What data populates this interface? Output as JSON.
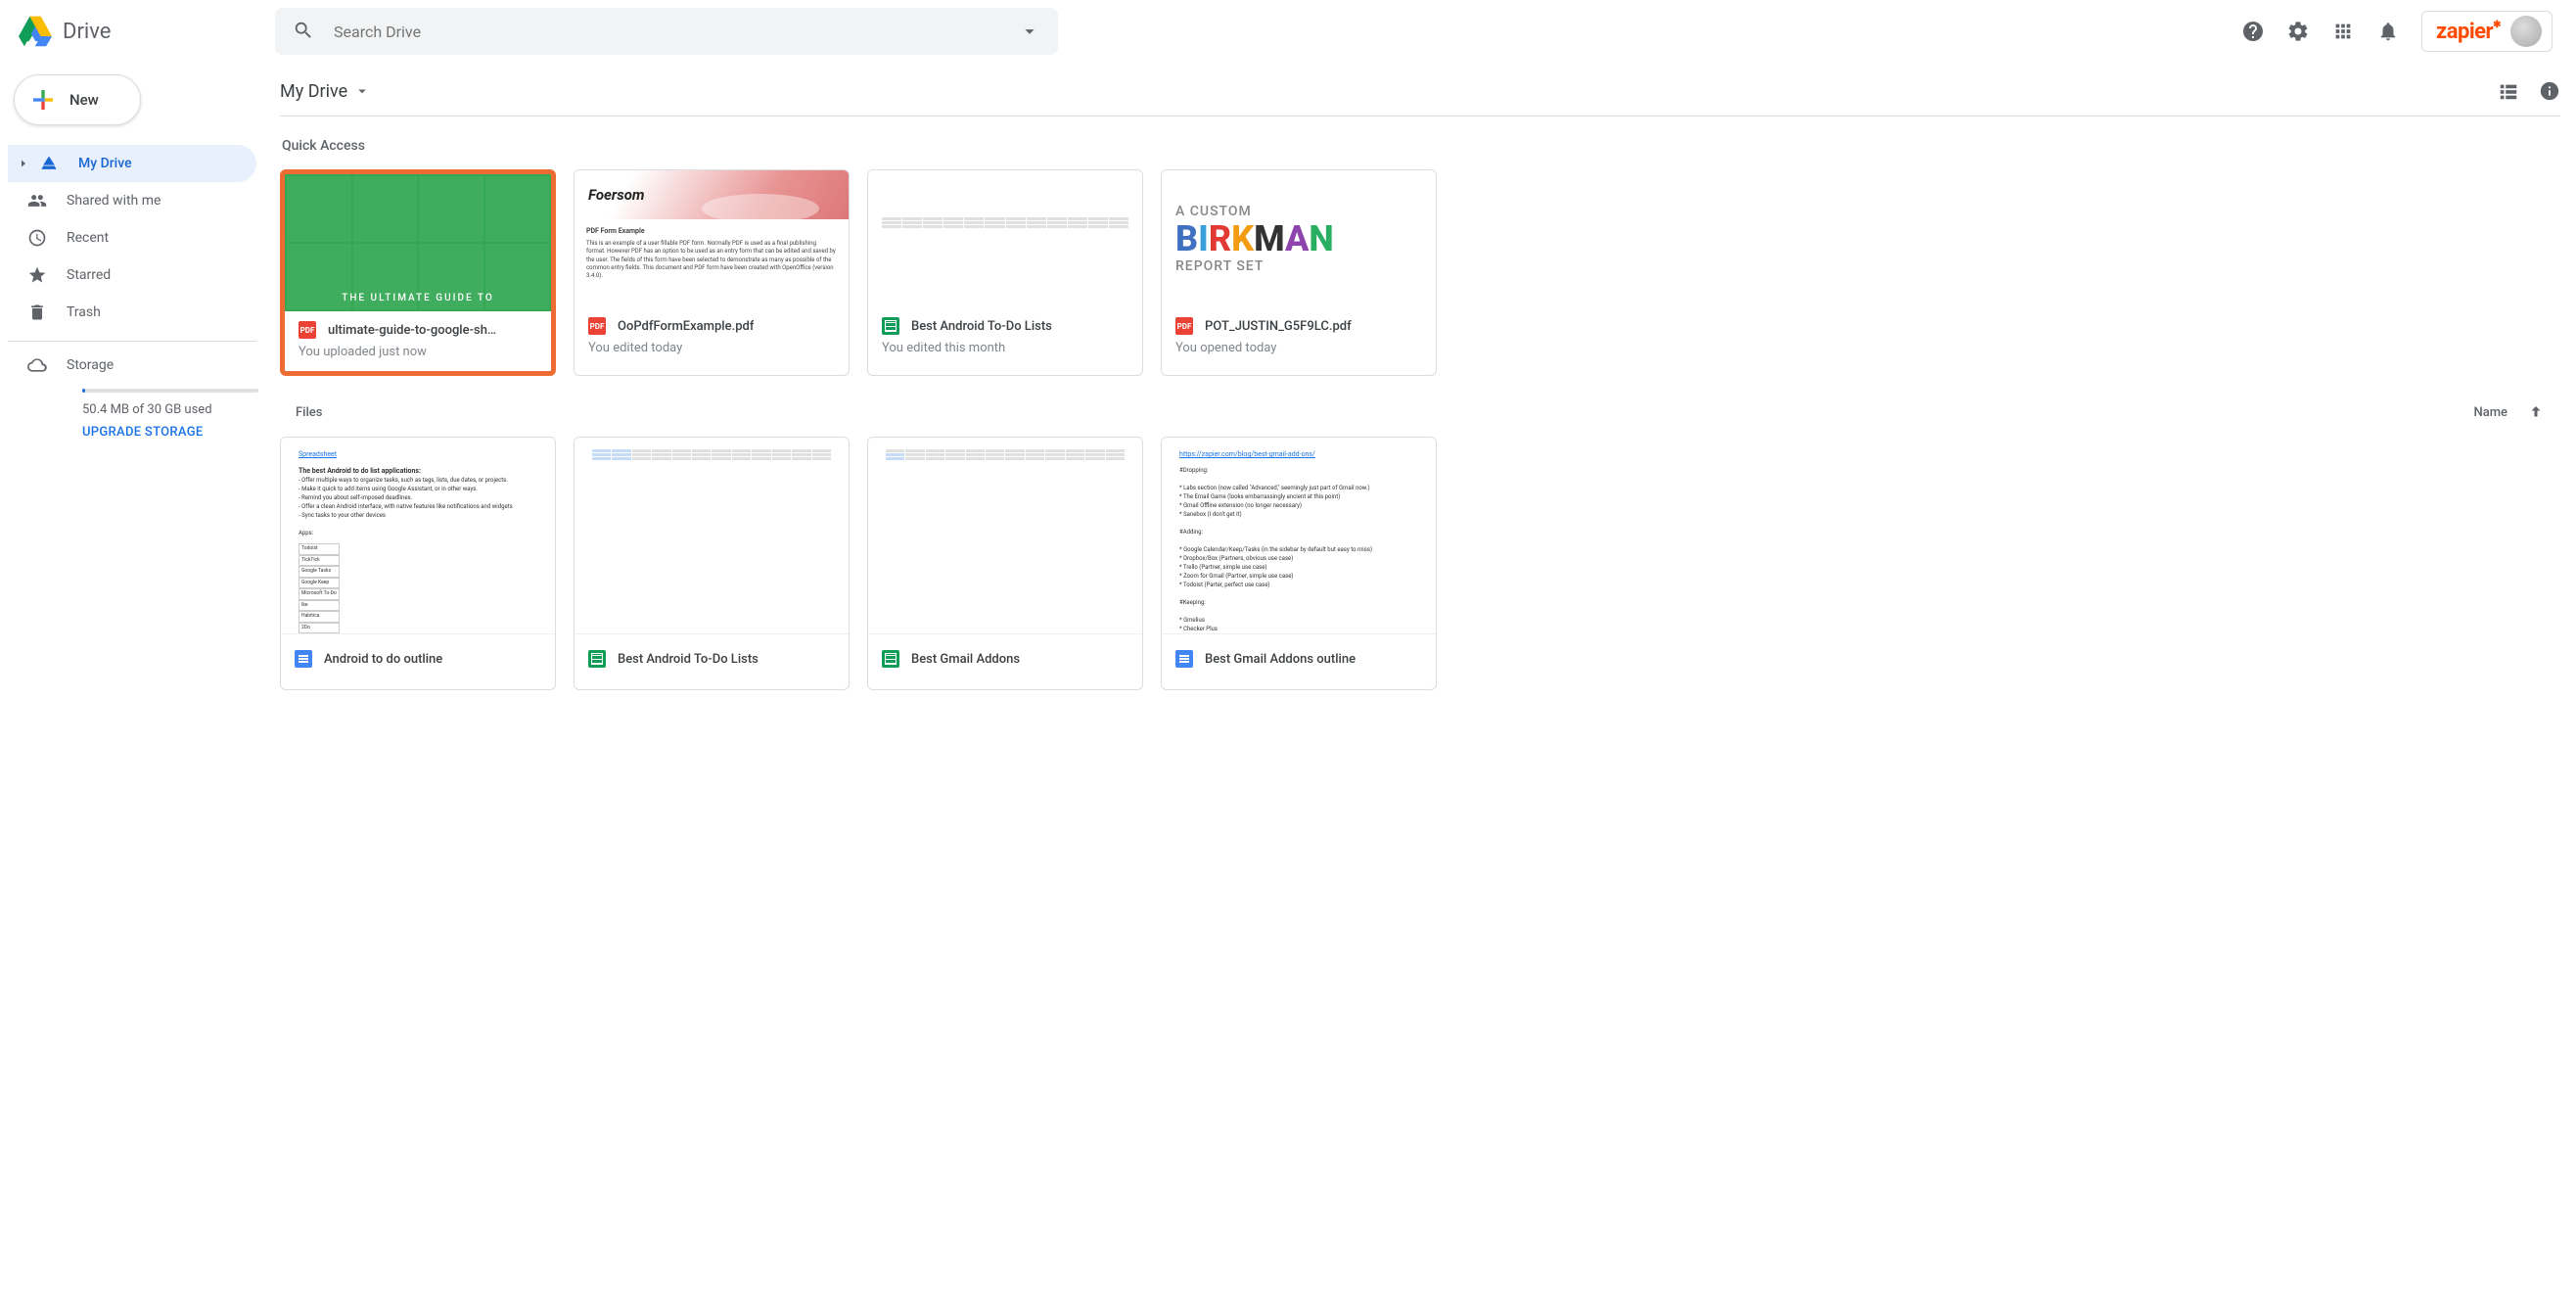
{
  "app_name": "Drive",
  "search": {
    "placeholder": "Search Drive"
  },
  "brand": "zapier",
  "new_button": "New",
  "nav": {
    "my_drive": "My Drive",
    "shared": "Shared with me",
    "recent": "Recent",
    "starred": "Starred",
    "trash": "Trash"
  },
  "storage": {
    "label": "Storage",
    "used": "50.4 MB of 30 GB used",
    "upgrade": "UPGRADE STORAGE"
  },
  "path": "My Drive",
  "quick_access": {
    "title": "Quick Access",
    "items": [
      {
        "name": "ultimate-guide-to-google-sh…",
        "sub": "You uploaded just now",
        "thumb_text": "THE ULTIMATE GUIDE TO"
      },
      {
        "name": "OoPdfFormExample.pdf",
        "sub": "You edited today",
        "brand": "Foersom",
        "body_title": "PDF Form Example",
        "body_text": "This is an example of a user fillable PDF form. Normally PDF is used as a final publishing format. However PDF has an option to be used as an entry form that can be edited and saved by the user. The fields of this form have been selected to demonstrate as many as possible of the common entry fields. This document and PDF form have been created with OpenOffice (version 3.4.0)."
      },
      {
        "name": "Best Android To-Do Lists",
        "sub": "You edited this month"
      },
      {
        "name": "POT_JUSTIN_G5F9LC.pdf",
        "sub": "You opened today",
        "line1": "A CUSTOM",
        "line2": "BIRKMAN",
        "line3": "REPORT SET"
      }
    ]
  },
  "files_header": {
    "left": "Files",
    "sort": "Name"
  },
  "files": [
    {
      "name": "Android to do outline"
    },
    {
      "name": "Best Android To-Do Lists"
    },
    {
      "name": "Best Gmail Addons"
    },
    {
      "name": "Best Gmail Addons outline"
    }
  ]
}
